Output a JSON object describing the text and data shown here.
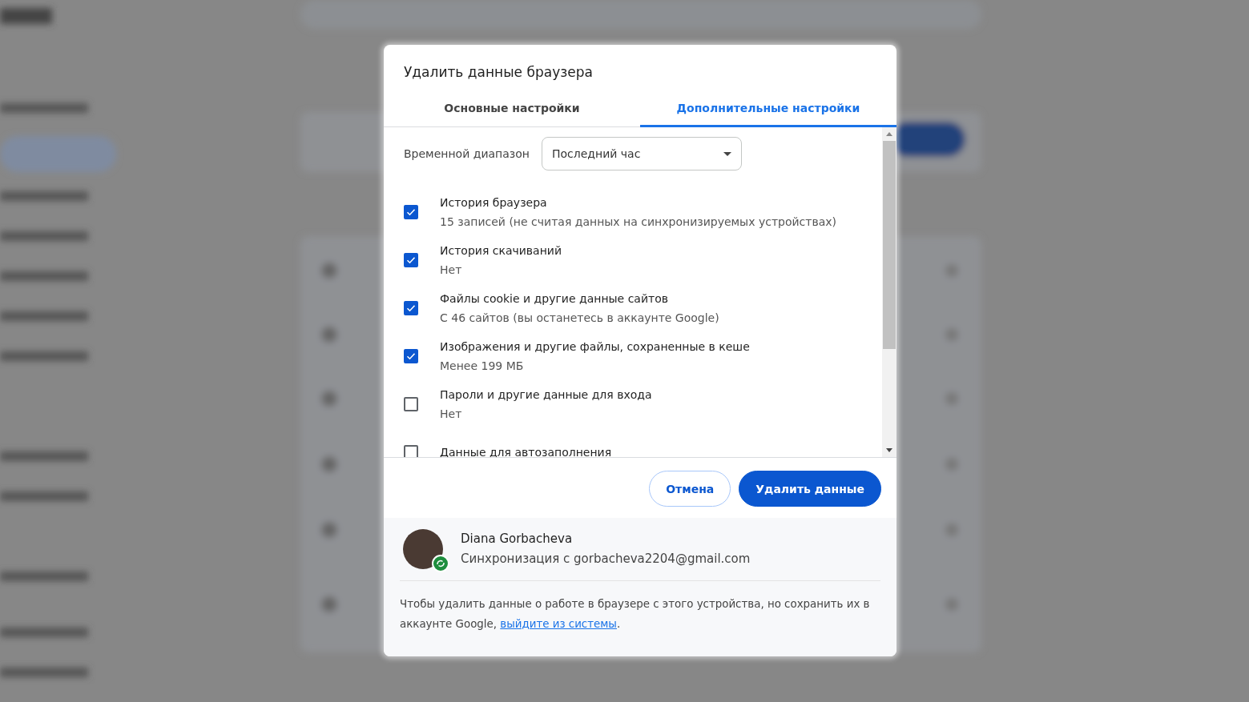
{
  "dialog": {
    "title": "Удалить данные браузера",
    "tabs": [
      {
        "label": "Основные настройки",
        "selected": false
      },
      {
        "label": "Дополнительные настройки",
        "selected": true
      }
    ],
    "time_range": {
      "label": "Временной диапазон",
      "value": "Последний час"
    },
    "items": [
      {
        "label": "История браузера",
        "detail": "15 записей (не считая данных на синхронизируемых устройствах)",
        "checked": true
      },
      {
        "label": "История скачиваний",
        "detail": "Нет",
        "checked": true
      },
      {
        "label": "Файлы cookie и другие данные сайтов",
        "detail": "С 46 сайтов (вы останетесь в аккаунте Google)",
        "checked": true
      },
      {
        "label": "Изображения и другие файлы, сохраненные в кеше",
        "detail": "Менее 199 МБ",
        "checked": true
      },
      {
        "label": "Пароли и другие данные для входа",
        "detail": "Нет",
        "checked": false
      },
      {
        "label": "Данные для автозаполнения",
        "checked": false
      }
    ],
    "buttons": [
      {
        "label": "Отмена",
        "kind": "secondary"
      },
      {
        "label": "Удалить данные",
        "kind": "primary"
      }
    ],
    "account": {
      "name": "Diana Gorbacheva",
      "sync": "Синхронизация с gorbacheva2204@gmail.com"
    },
    "note": {
      "text": "Чтобы удалить данные о работе в браузере с этого устройства, но сохранить их в аккаунте Google, ",
      "link": "выйдите из системы",
      "after": "."
    }
  }
}
